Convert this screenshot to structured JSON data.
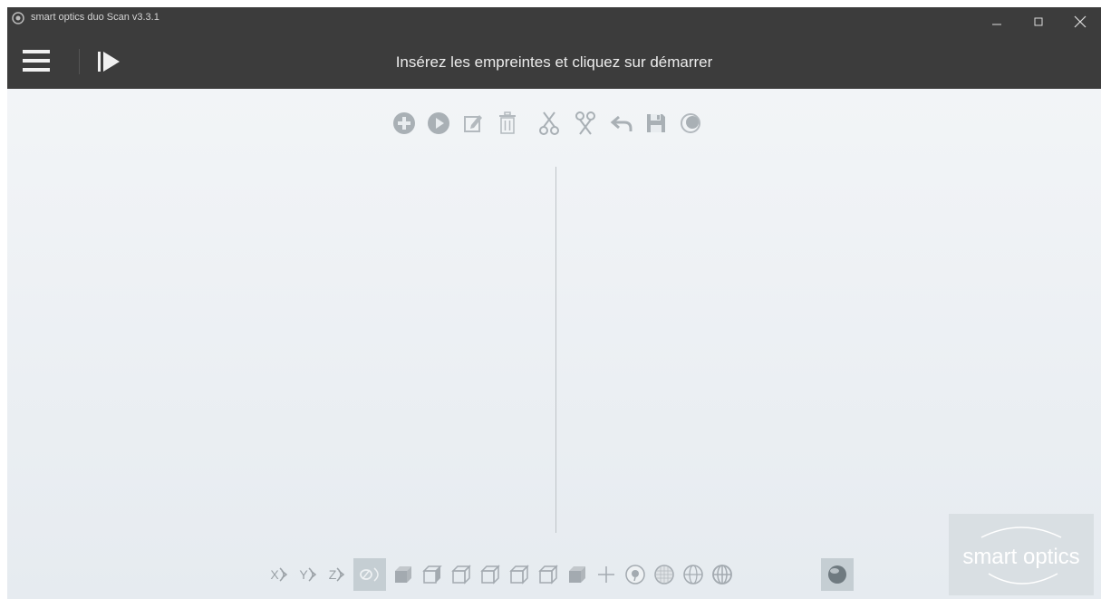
{
  "window": {
    "title": "smart optics duo Scan v3.3.1"
  },
  "header": {
    "instruction": "Insérez les empreintes et cliquez sur démarrer"
  },
  "bottom_toolbar": {
    "x_label": "X",
    "y_label": "Y",
    "z_label": "Z"
  },
  "logo": {
    "text": "smart optics"
  },
  "colors": {
    "header_bg": "#3c3c3c",
    "icon_gray": "#a9b0b5",
    "content_bg_top": "#f4f6f8",
    "content_bg_bottom": "#e6ebf0"
  }
}
